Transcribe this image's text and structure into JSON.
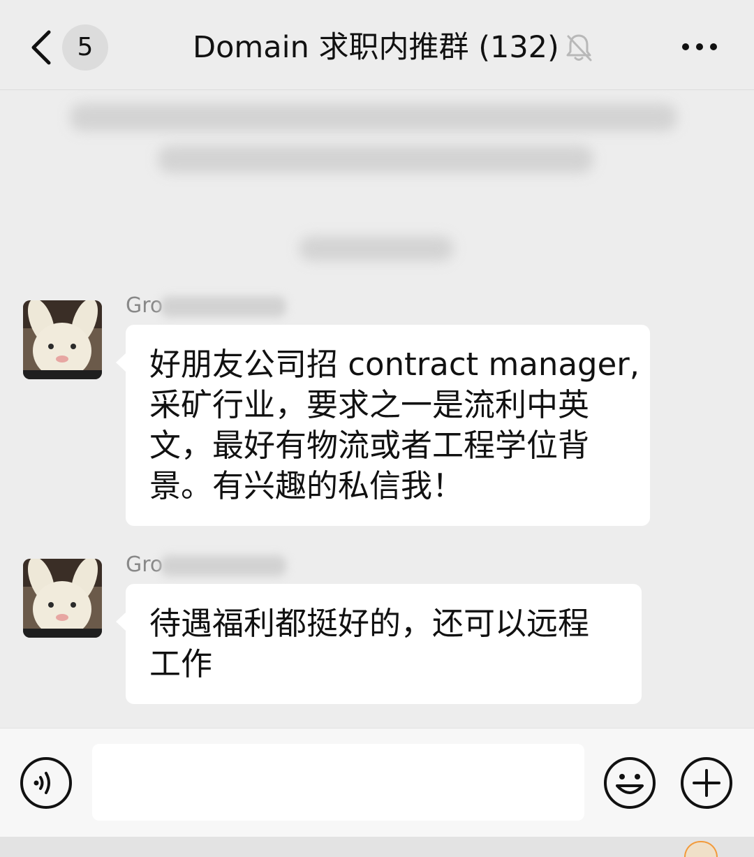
{
  "header": {
    "unread_count": "5",
    "title": "Domain 求职内推群 (132)",
    "muted": true
  },
  "messages": [
    {
      "sender": "Gro",
      "lines": [
        "好朋友公司招 contract manager,",
        " 采矿行业，要求之一是流利中英",
        "文，最好有物流或者工程学位背",
        "景。有兴趣的私信我！"
      ]
    },
    {
      "sender": "Gro",
      "lines": [
        "待遇福利都挺好的，还可以远程",
        "工作"
      ]
    }
  ],
  "input_bar": {
    "placeholder": "",
    "icons": [
      "voice-icon",
      "emoji-icon",
      "plus-icon"
    ]
  },
  "colors": {
    "background": "#ededed",
    "bubble": "#ffffff",
    "input_bar": "#f7f7f7"
  }
}
